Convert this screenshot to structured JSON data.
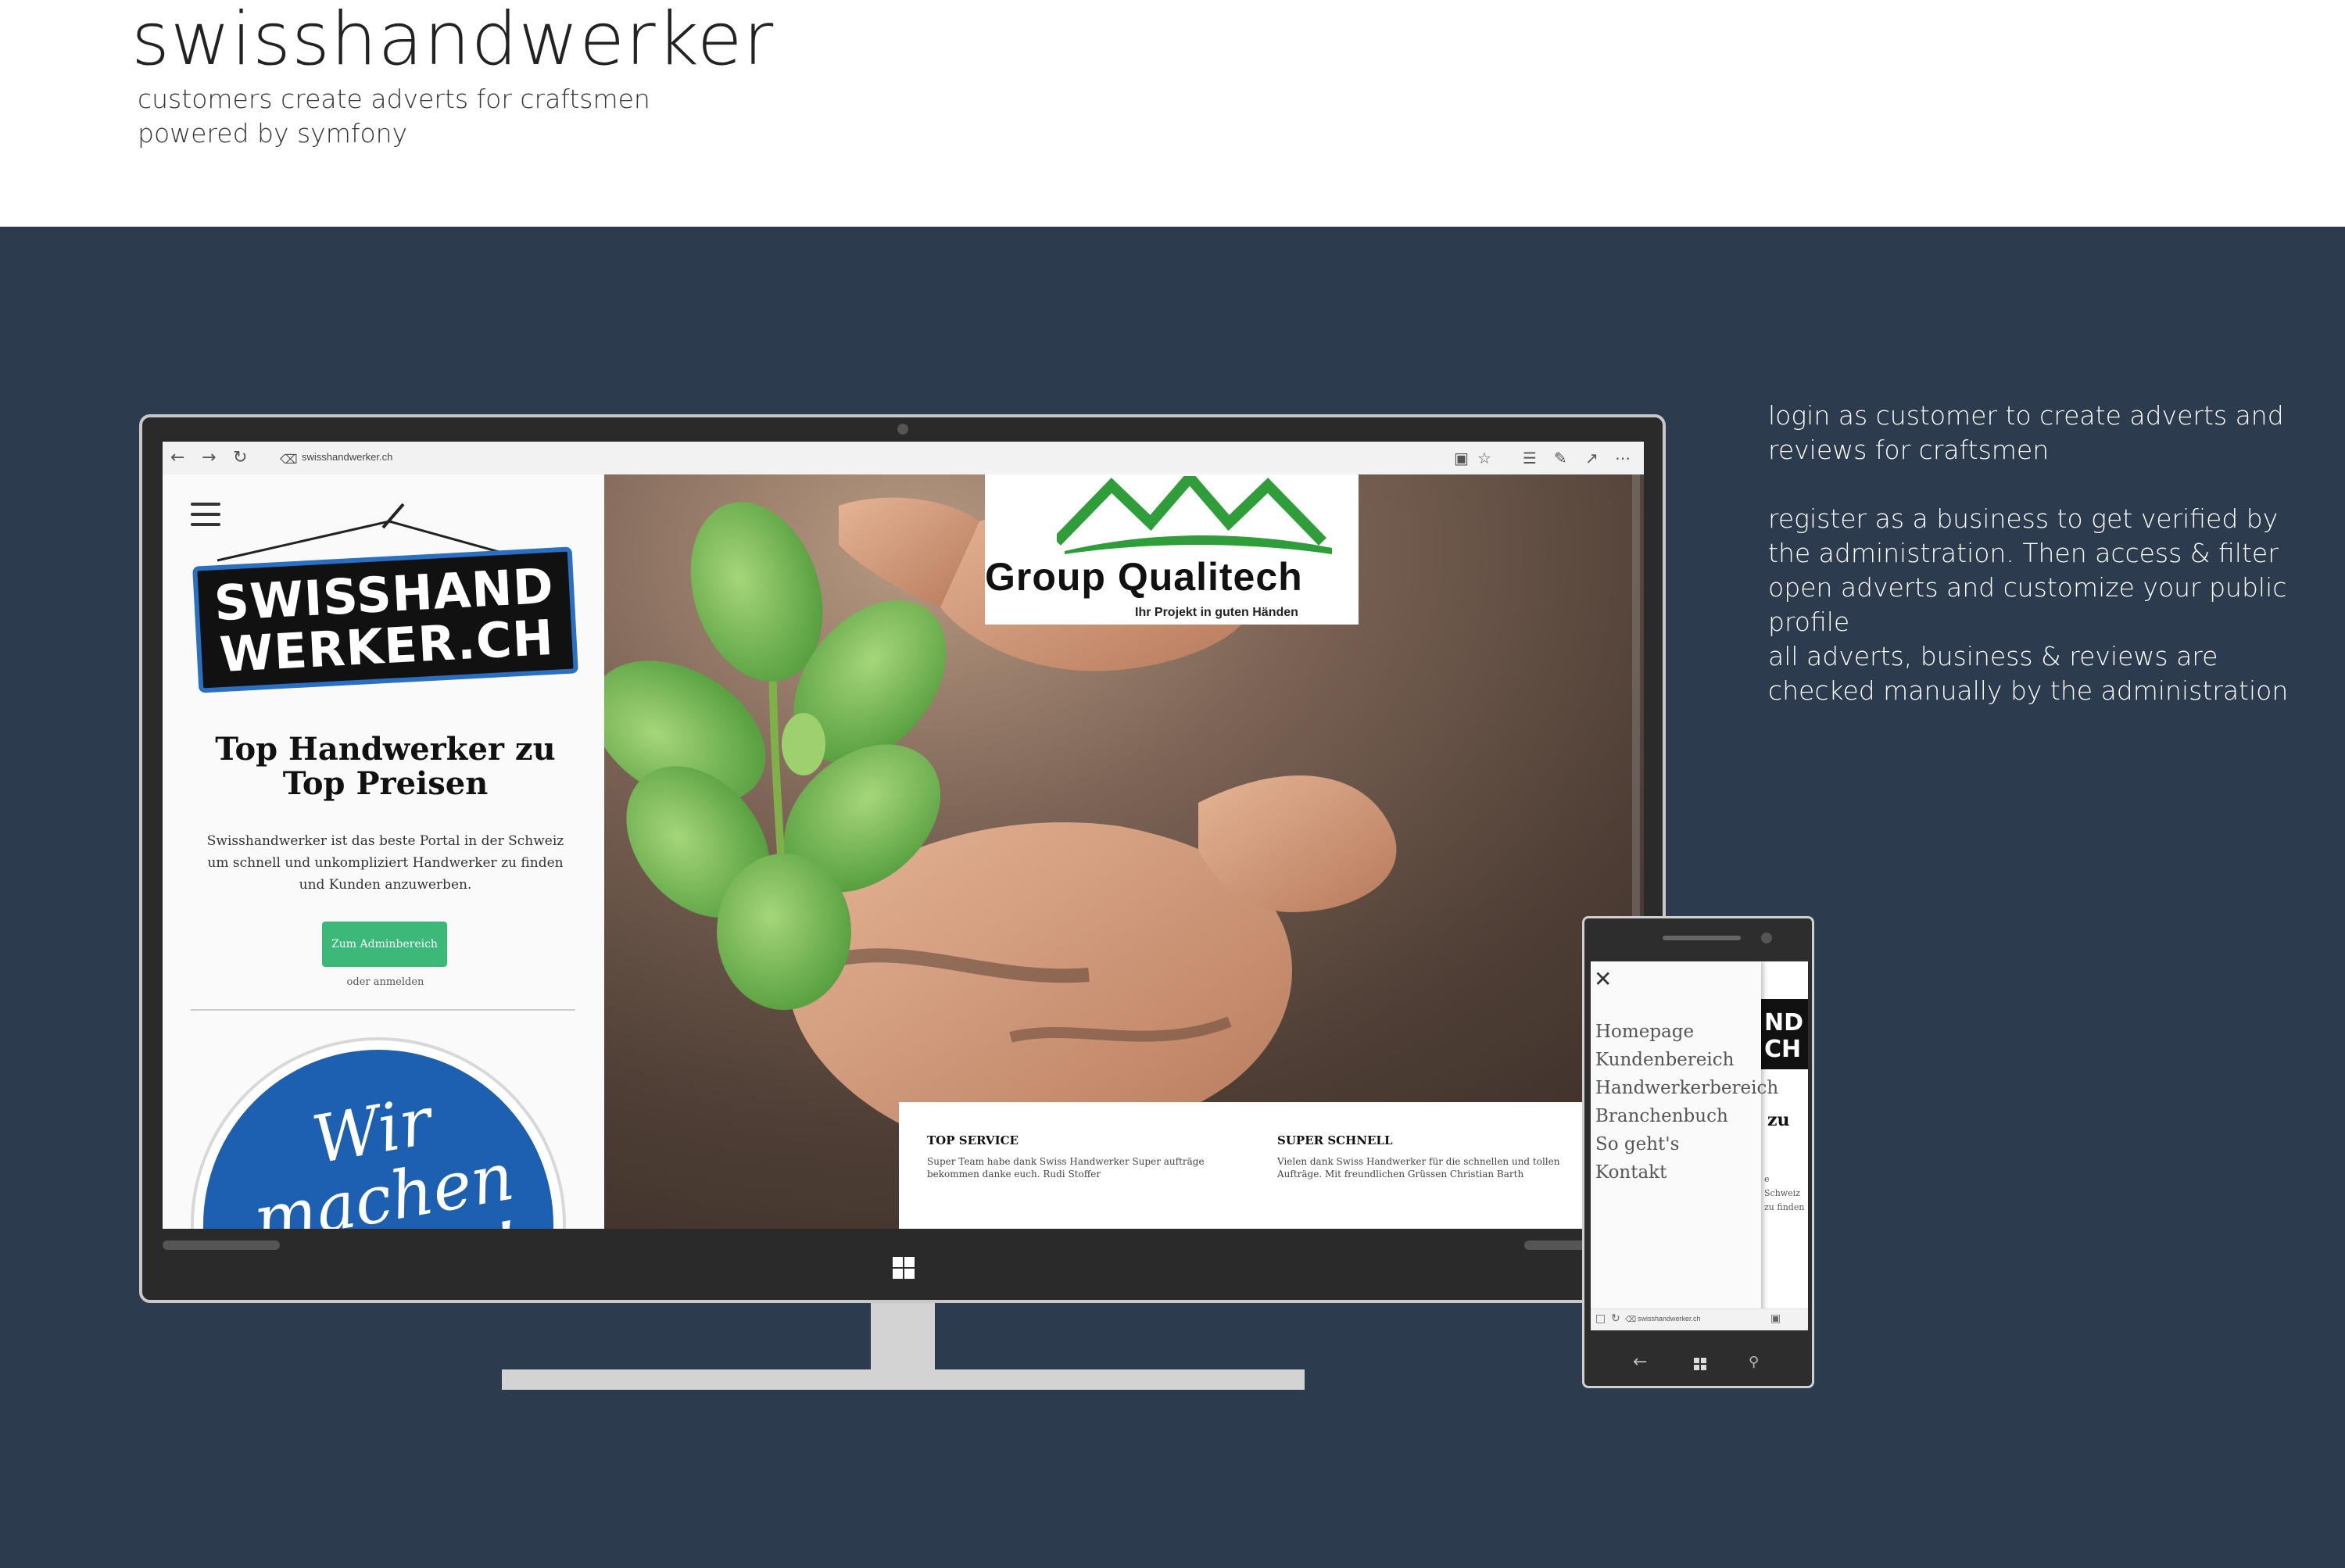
{
  "header": {
    "title": "swisshandwerker",
    "subtitle_line1": "customers create adverts for craftsmen",
    "subtitle_line2": "powered by symfony"
  },
  "description": {
    "paragraph1": "login as customer to create adverts and reviews for craftsmen",
    "paragraph2": "register as a business to get verified by the administration. Then access & filter open adverts and customize your public profile",
    "paragraph3": "all adverts, business & reviews are checked manually by the administration"
  },
  "browser": {
    "url": "swisshandwerker.ch",
    "icons": [
      "back-icon",
      "forward-icon",
      "refresh-icon",
      "lock-icon",
      "reading-view-icon",
      "favorite-star-icon",
      "hub-icon",
      "notes-pen-icon",
      "share-icon",
      "more-icon"
    ]
  },
  "site": {
    "logo_line1": "SWISSHAND",
    "logo_line2": "WERKER.CH",
    "hero_title": "Top Handwerker zu Top Preisen",
    "hero_text": "Swisshandwerker ist das beste Portal in der Schweiz um schnell und unkompliziert Handwerker zu finden und Kunden anzuwerben.",
    "admin_button": "Zum Adminbereich",
    "login_link": "oder anmelden",
    "badge_text": "Wir machen für Sie!",
    "sponsor_name": "Group Qualitech",
    "sponsor_tagline": "Ihr Projekt in guten Händen",
    "testimonials": [
      {
        "title": "TOP SERVICE",
        "text": "Super Team habe dank Swiss Handwerker Super aufträge bekommen danke euch. Rudi Stoffer"
      },
      {
        "title": "SUPER SCHNELL",
        "text": "Vielen dank Swiss Handwerker für die schnellen und tollen Aufträge. Mit freundlichen Grüssen Christian Barth"
      }
    ]
  },
  "phone": {
    "menu_items": [
      "Homepage",
      "Kundenbereich",
      "Handwerkerbereich",
      "Branchenbuch",
      "So geht's",
      "Kontakt"
    ],
    "close_icon": "close-icon",
    "url": "swisshandwerker.ch",
    "peek_logo": "ND\nCH",
    "peek_heading": "zu",
    "peek_text": "e Schweiz\nzu finden"
  },
  "colors": {
    "band": "#2c3c4e",
    "button_green": "#3cb878",
    "logo_blue": "#2a6fc2",
    "badge_blue": "#1d5fb0",
    "qualitech_green": "#2f9e3a"
  }
}
